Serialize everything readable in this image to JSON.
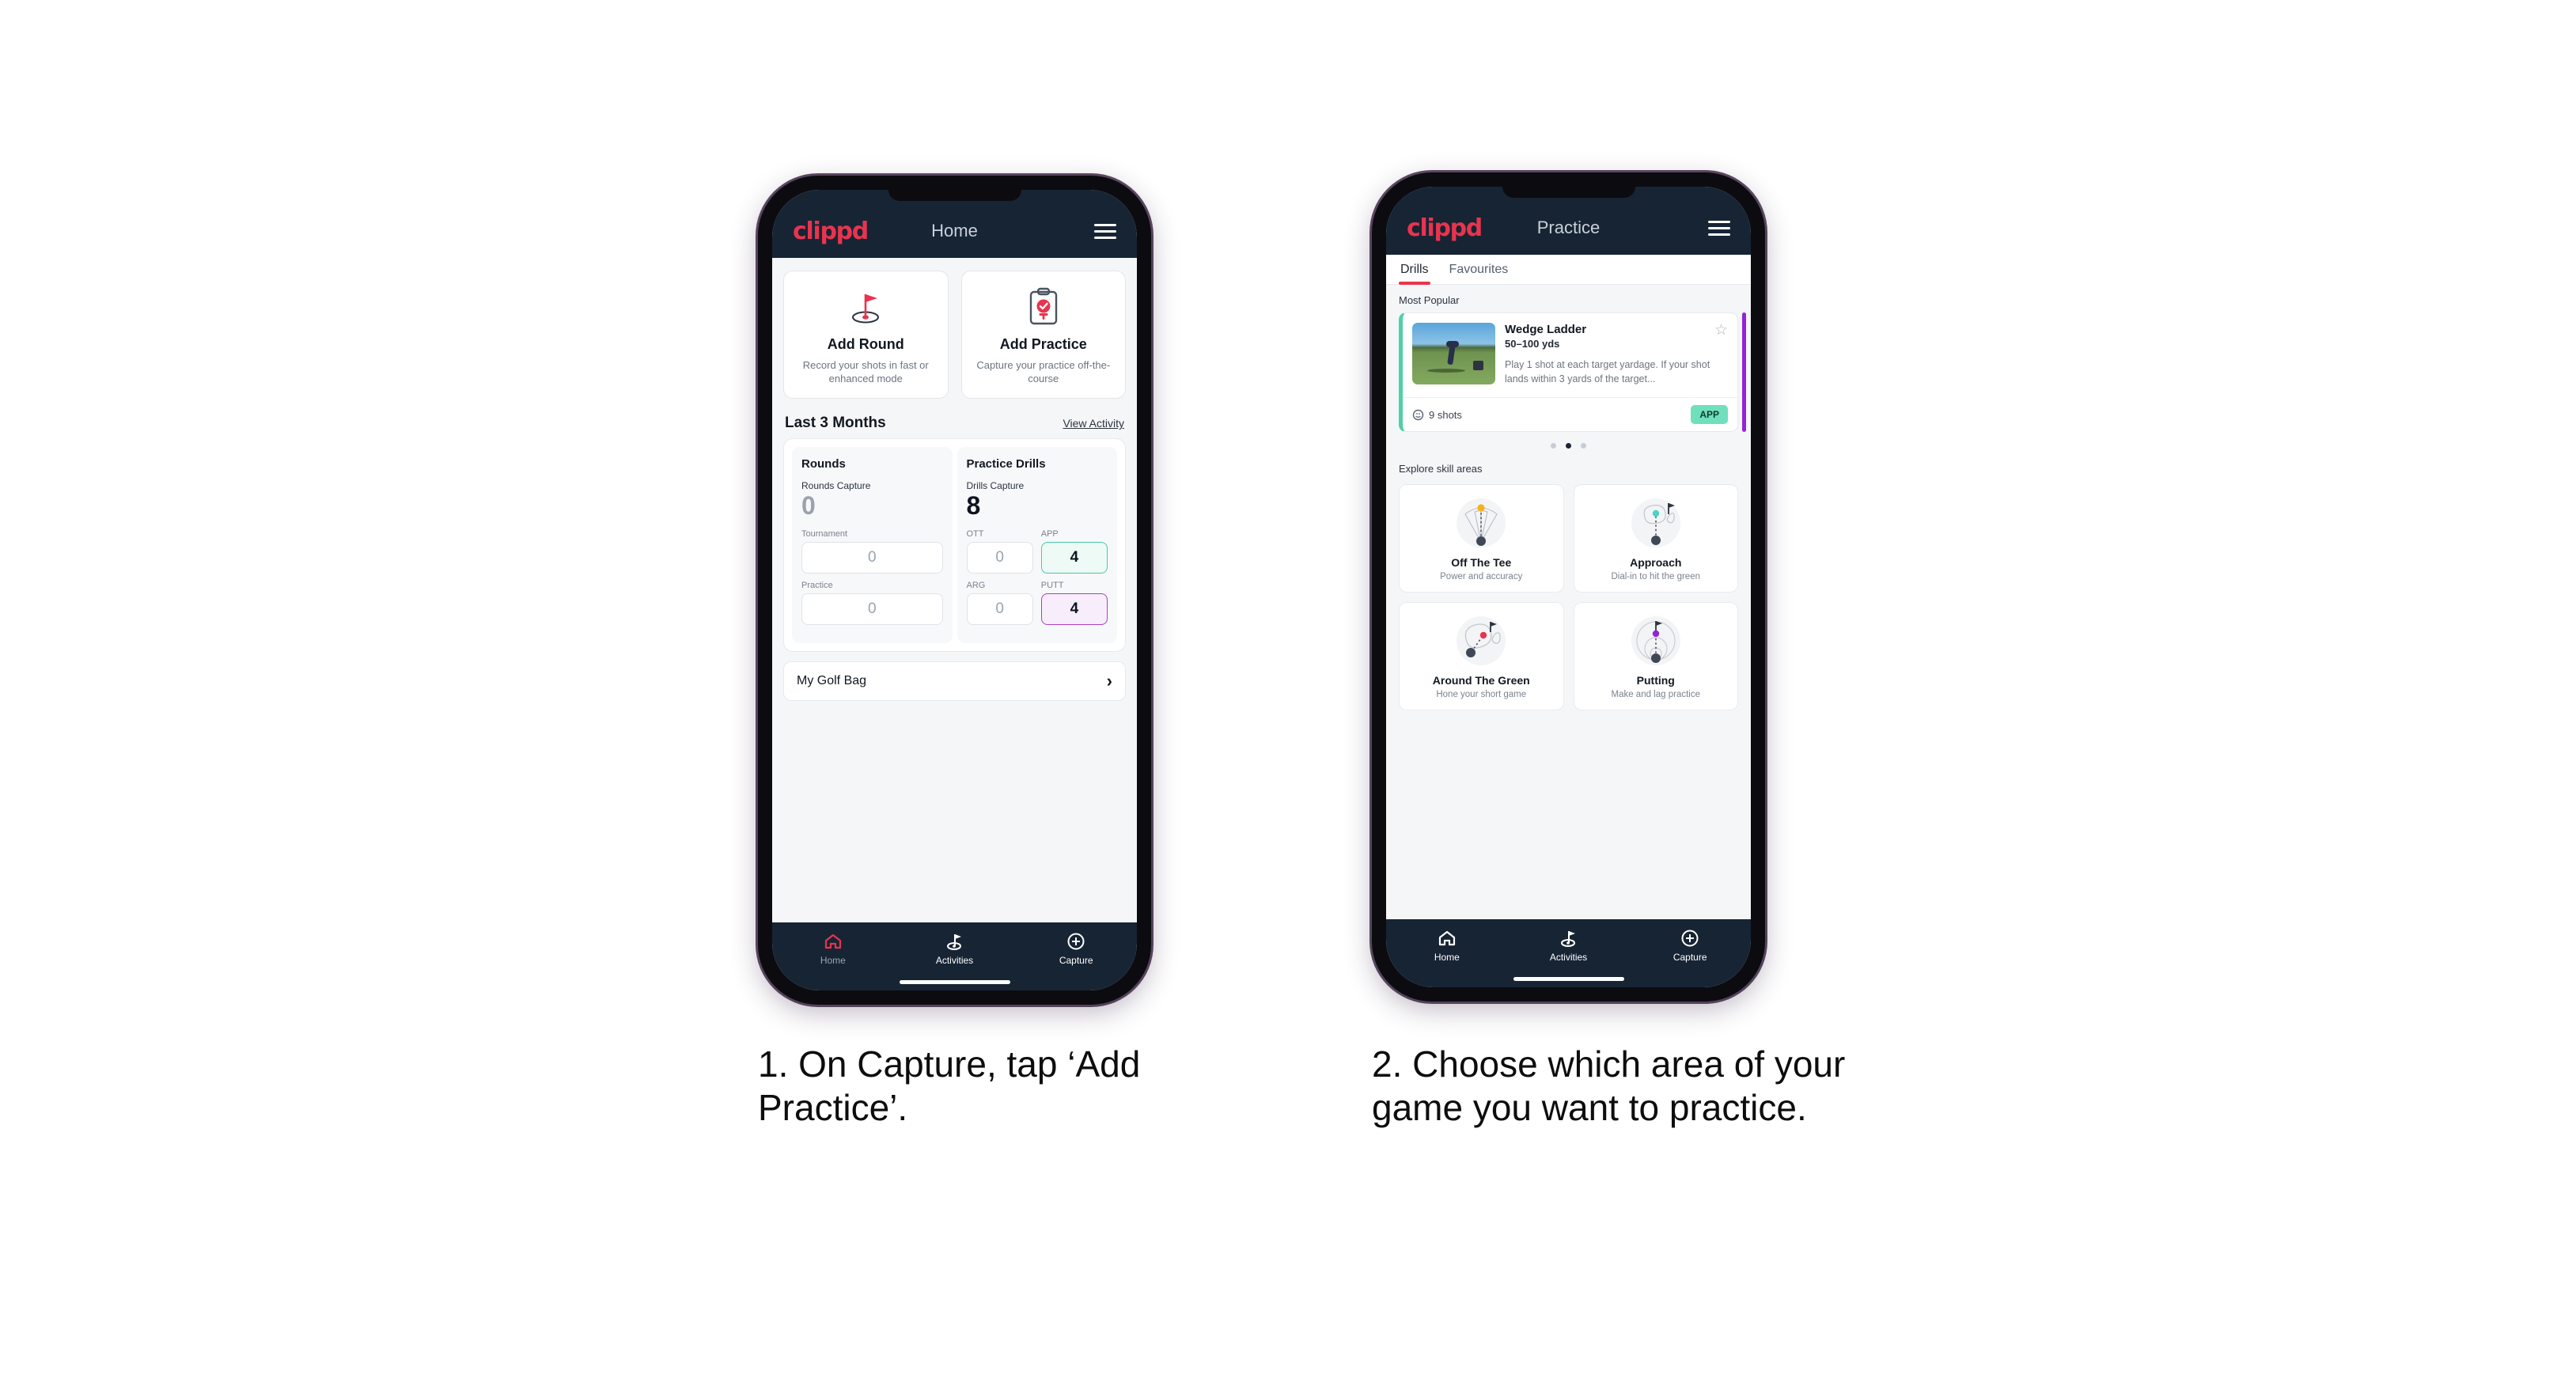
{
  "brand": {
    "logo_text": "clippd",
    "accent": "#e8344e",
    "header_bg": "#172434"
  },
  "phone1": {
    "appbar": {
      "logo": "clippd",
      "title": "Home",
      "menu_icon": "hamburger-icon"
    },
    "tiles": [
      {
        "icon": "golf-flag-hole-icon",
        "title": "Add Round",
        "sub": "Record your shots in fast or enhanced mode"
      },
      {
        "icon": "clipboard-check-tee-icon",
        "title": "Add Practice",
        "sub": "Capture your practice off-the-course"
      }
    ],
    "section": {
      "title": "Last 3 Months",
      "link": "View Activity"
    },
    "rounds": {
      "heading": "Rounds",
      "capture_label": "Rounds Capture",
      "capture_value": "0",
      "fields": [
        {
          "label": "Tournament",
          "value": "0",
          "style": "plain"
        },
        {
          "label": "Practice",
          "value": "0",
          "style": "plain"
        }
      ]
    },
    "drills": {
      "heading": "Practice Drills",
      "capture_label": "Drills Capture",
      "capture_value": "8",
      "fields": [
        {
          "label": "OTT",
          "value": "0",
          "style": "plain"
        },
        {
          "label": "APP",
          "value": "4",
          "style": "app"
        },
        {
          "label": "ARG",
          "value": "0",
          "style": "plain"
        },
        {
          "label": "PUTT",
          "value": "4",
          "style": "putt"
        }
      ]
    },
    "golf_bag": {
      "label": "My Golf Bag",
      "chevron": "chevron-right-icon"
    },
    "nav": [
      {
        "icon": "home-icon",
        "label": "Home",
        "active": true
      },
      {
        "icon": "golf-flag-icon",
        "label": "Activities",
        "active": false
      },
      {
        "icon": "plus-circle-icon",
        "label": "Capture",
        "active": false
      }
    ]
  },
  "phone2": {
    "appbar": {
      "logo": "clippd",
      "title": "Practice",
      "menu_icon": "hamburger-icon"
    },
    "tabs": [
      {
        "label": "Drills",
        "active": true
      },
      {
        "label": "Favourites",
        "active": false
      }
    ],
    "most_popular_label": "Most Popular",
    "drill_card": {
      "title": "Wedge Ladder",
      "range": "50–100 yds",
      "description": "Play 1 shot at each target yardage. If your shot lands within 3 yards of the target...",
      "shots": "9 shots",
      "badge": "APP",
      "badge_color": "#6fe0bb",
      "accent_color": "#4fd1a5",
      "next_accent_color": "#9425d6",
      "star_icon": "star-outline-icon",
      "clock_icon": "clock-icon"
    },
    "carousel_dots": {
      "count": 3,
      "active_index": 1
    },
    "explore_label": "Explore skill areas",
    "skill_areas": [
      {
        "icon": "off-the-tee-icon",
        "title": "Off The Tee",
        "sub": "Power and accuracy",
        "dot_color": "#f5b31b"
      },
      {
        "icon": "approach-icon",
        "title": "Approach",
        "sub": "Dial-in to hit the green",
        "dot_color": "#4fd1c5"
      },
      {
        "icon": "around-the-green-icon",
        "title": "Around The Green",
        "sub": "Hone your short game",
        "dot_color": "#e8344e"
      },
      {
        "icon": "putting-icon",
        "title": "Putting",
        "sub": "Make and lag practice",
        "dot_color": "#9425d6"
      }
    ],
    "nav": [
      {
        "icon": "home-icon",
        "label": "Home",
        "active": false
      },
      {
        "icon": "golf-flag-icon",
        "label": "Activities",
        "active": false
      },
      {
        "icon": "plus-circle-icon",
        "label": "Capture",
        "active": false
      }
    ]
  },
  "captions": {
    "step1": "1. On Capture, tap ‘Add Practice’.",
    "step2": "2. Choose which area of your game you want to practice."
  }
}
